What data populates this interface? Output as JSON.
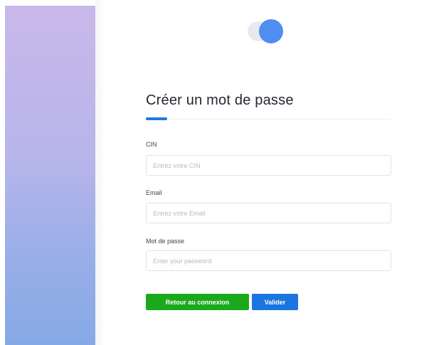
{
  "logo": {
    "icon": "toggle-circles-logo",
    "colors": {
      "back": "#e6e9ef",
      "front": "#4f8ef0"
    }
  },
  "form": {
    "title": "Créer un mot de passe",
    "fields": [
      {
        "label": "CIN",
        "placeholder": "Entrez votre CIN",
        "value": ""
      },
      {
        "label": "Email",
        "placeholder": "Entrez votre Email",
        "value": ""
      },
      {
        "label": "Mot de passe",
        "placeholder": "Enter your password",
        "value": ""
      }
    ],
    "buttons": {
      "back_label": "Retour au connexion",
      "submit_label": "Valider"
    }
  },
  "colors": {
    "accent": "#1f7ae0",
    "back_button": "#1ba91c",
    "submit_button": "#1a75e0"
  }
}
